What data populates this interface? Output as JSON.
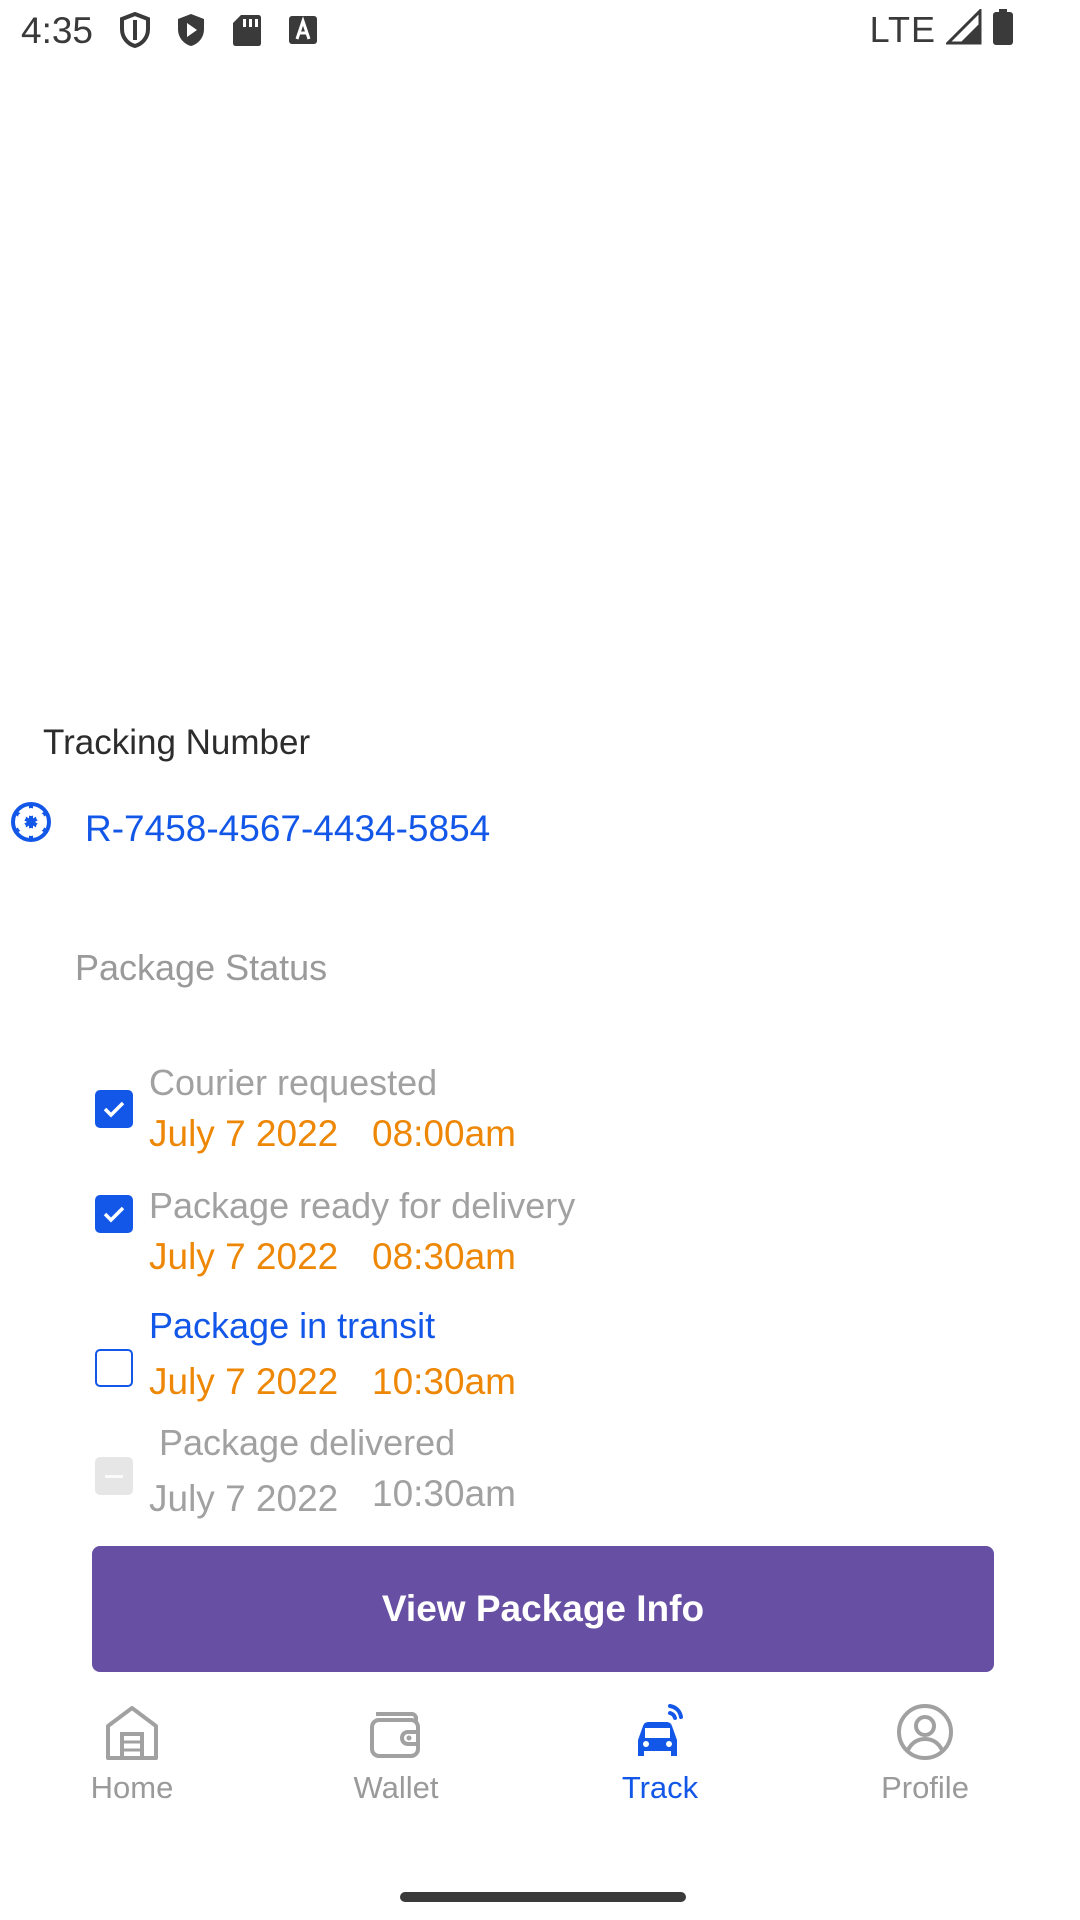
{
  "status_bar": {
    "time": "4:35",
    "network": "LTE",
    "icons": [
      "shield-outline-icon",
      "shield-play-icon",
      "sd-card-icon",
      "a-box-icon",
      "signal-icon",
      "battery-icon"
    ]
  },
  "tracking": {
    "label": "Tracking Number",
    "number": "R-7458-4567-4434-5854",
    "icon": "wheel-icon"
  },
  "package_status": {
    "title": "Package Status",
    "items": [
      {
        "title": "Courier requested",
        "date": "July 7 2022",
        "time": "08:00am",
        "state": "checked"
      },
      {
        "title": "Package ready for delivery",
        "date": "July 7 2022",
        "time": "08:30am",
        "state": "checked"
      },
      {
        "title": "Package in transit",
        "date": "July 7 2022",
        "time": "10:30am",
        "state": "unchecked"
      },
      {
        "title": "Package delivered",
        "date": "July 7 2022",
        "time": "10:30am",
        "state": "disabled"
      }
    ]
  },
  "actions": {
    "view_package_info": "View Package Info"
  },
  "bottom_nav": {
    "items": [
      {
        "label": "Home",
        "icon": "home-icon",
        "active": false
      },
      {
        "label": "Wallet",
        "icon": "wallet-icon",
        "active": false
      },
      {
        "label": "Track",
        "icon": "car-tracking-icon",
        "active": true
      },
      {
        "label": "Profile",
        "icon": "profile-icon",
        "active": false
      }
    ]
  },
  "colors": {
    "accent_blue": "#1357e8",
    "orange": "#ed8705",
    "button_purple": "#6750a4",
    "muted_grey": "#a1a1a1"
  }
}
